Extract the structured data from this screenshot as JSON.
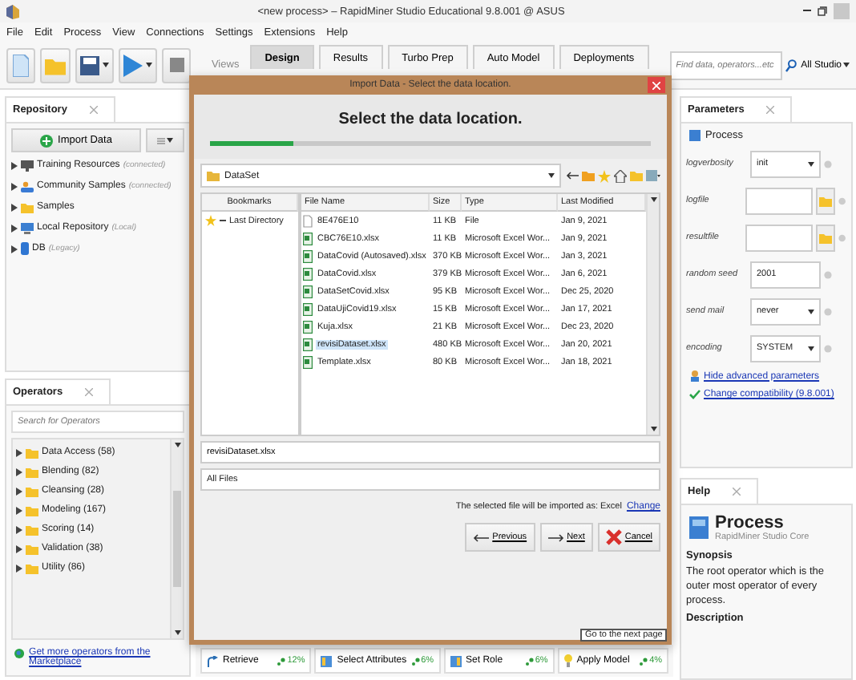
{
  "window": {
    "title": "<new process> – RapidMiner Studio Educational 9.8.001 @ ASUS"
  },
  "menu": [
    "File",
    "Edit",
    "Process",
    "View",
    "Connections",
    "Settings",
    "Extensions",
    "Help"
  ],
  "toolbar": {
    "views_label": "Views",
    "views": [
      {
        "label": "Design",
        "selected": true
      },
      {
        "label": "Results",
        "selected": false
      },
      {
        "label": "Turbo Prep",
        "selected": false
      },
      {
        "label": "Auto Model",
        "selected": false
      },
      {
        "label": "Deployments",
        "selected": false
      }
    ],
    "search": {
      "placeholder": "Find data, operators...etc"
    },
    "scope": "All Studio"
  },
  "repository": {
    "title": "Repository",
    "import_button": "Import Data",
    "items": [
      {
        "kind": "training",
        "label": "Training Resources",
        "note": "(connected)"
      },
      {
        "kind": "community",
        "label": "Community Samples",
        "note": "(connected)"
      },
      {
        "kind": "folder",
        "label": "Samples"
      },
      {
        "kind": "local",
        "label": "Local Repository",
        "note": "(Local)"
      },
      {
        "kind": "db",
        "label": "DB",
        "note": "(Legacy)"
      }
    ]
  },
  "operators": {
    "title": "Operators",
    "search": {
      "placeholder": "Search for Operators"
    },
    "groups": [
      "Data Access (58)",
      "Blending (82)",
      "Cleansing (28)",
      "Modeling (167)",
      "Scoring (14)",
      "Validation (38)",
      "Utility (86)"
    ],
    "marketplace_link": "Get more operators from the Marketplace"
  },
  "process_operators": [
    {
      "kind": "retrieve",
      "label": "Retrieve",
      "usage": "12%"
    },
    {
      "kind": "attributes",
      "label": "Select Attributes",
      "usage": "6%"
    },
    {
      "kind": "role",
      "label": "Set Role",
      "usage": "6%"
    },
    {
      "kind": "model",
      "label": "Apply Model",
      "usage": "4%"
    }
  ],
  "parameters": {
    "title": "Parameters",
    "process": "Process",
    "rows": [
      {
        "label": "logverbosity",
        "kind": "select",
        "value": "init"
      },
      {
        "label": "logfile",
        "kind": "file"
      },
      {
        "label": "resultfile",
        "kind": "file"
      },
      {
        "label": "random seed",
        "kind": "text",
        "value": "2001"
      },
      {
        "label": "send mail",
        "kind": "select",
        "value": "never"
      },
      {
        "label": "encoding",
        "kind": "select",
        "value": "SYSTEM"
      }
    ],
    "links": [
      {
        "kind": "hide",
        "label": "Hide advanced parameters"
      },
      {
        "kind": "compat",
        "label": "Change compatibility (9.8.001)"
      }
    ]
  },
  "help": {
    "title": "Help",
    "heading": "Process",
    "subheading": "RapidMiner Studio Core",
    "synopsis_label": "Synopsis",
    "synopsis": "The root operator which is the outer most operator of every process.",
    "description_label": "Description"
  },
  "dialog": {
    "title": "Import Data - Select the data location.",
    "heading": "Select the data location.",
    "progress": {
      "level": 0.19
    },
    "location": "DataSet",
    "bookmarks_header": "Bookmarks",
    "bookmarks": [
      "Last Directory"
    ],
    "columns": [
      "File Name",
      "Size",
      "Type",
      "Last Modified"
    ],
    "files": [
      {
        "kind": "file",
        "name": "8E476E10",
        "size": "11 KB",
        "type": "File",
        "modified": "Jan 9, 2021",
        "selected": false
      },
      {
        "kind": "excel",
        "name": "CBC76E10.xlsx",
        "size": "11 KB",
        "type": "Microsoft Excel Wor...",
        "modified": "Jan 9, 2021",
        "selected": false
      },
      {
        "kind": "excel",
        "name": "DataCovid (Autosaved).xlsx",
        "size": "370 KB",
        "type": "Microsoft Excel Wor...",
        "modified": "Jan 3, 2021",
        "selected": false
      },
      {
        "kind": "excel",
        "name": "DataCovid.xlsx",
        "size": "379 KB",
        "type": "Microsoft Excel Wor...",
        "modified": "Jan 6, 2021",
        "selected": false
      },
      {
        "kind": "excel",
        "name": "DataSetCovid.xlsx",
        "size": "95 KB",
        "type": "Microsoft Excel Wor...",
        "modified": "Dec 25, 2020",
        "selected": false
      },
      {
        "kind": "excel",
        "name": "DataUjiCovid19.xlsx",
        "size": "15 KB",
        "type": "Microsoft Excel Wor...",
        "modified": "Jan 17, 2021",
        "selected": false
      },
      {
        "kind": "excel",
        "name": "Kuja.xlsx",
        "size": "21 KB",
        "type": "Microsoft Excel Wor...",
        "modified": "Dec 23, 2020",
        "selected": false
      },
      {
        "kind": "excel",
        "name": "revisiDataset.xlsx",
        "size": "480 KB",
        "type": "Microsoft Excel Wor...",
        "modified": "Jan 20, 2021",
        "selected": true
      },
      {
        "kind": "excel",
        "name": "Template.xlsx",
        "size": "80 KB",
        "type": "Microsoft Excel Wor...",
        "modified": "Jan 18, 2021",
        "selected": false
      }
    ],
    "file_name": "revisiDataset.xlsx",
    "filter": "All Files",
    "note": "The selected file will be imported as: Excel",
    "change_link": "Change",
    "buttons": [
      {
        "kind": "previous",
        "label": "Previous"
      },
      {
        "kind": "next",
        "label": "Next"
      },
      {
        "kind": "cancel",
        "label": "Cancel"
      }
    ],
    "tooltip": "Go to the next page"
  }
}
